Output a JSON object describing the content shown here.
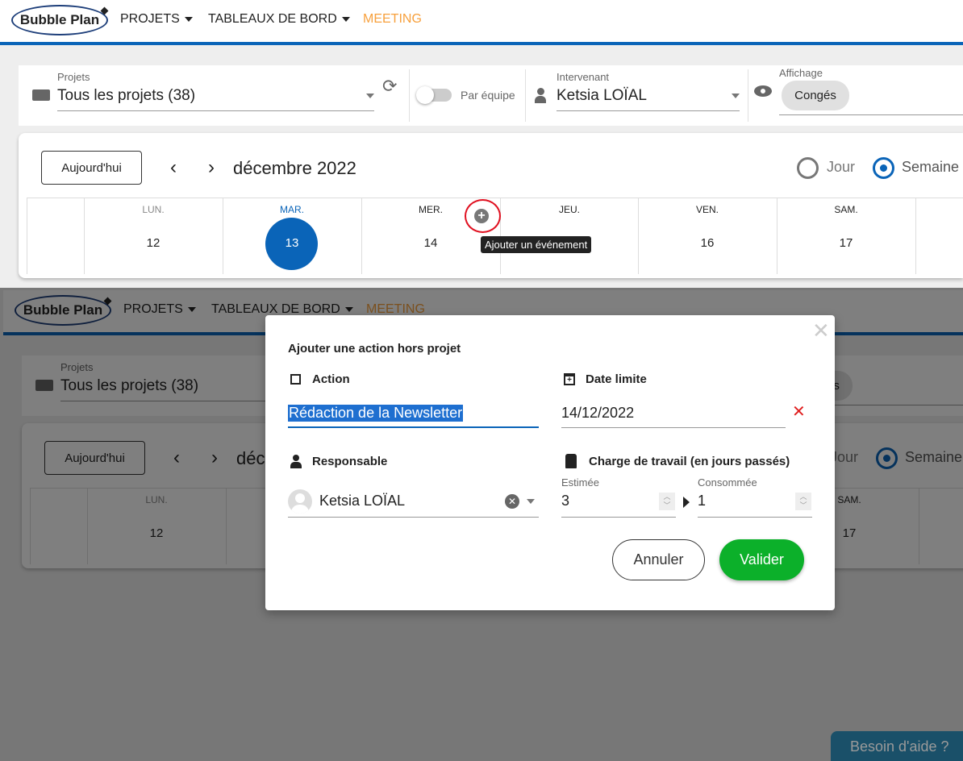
{
  "header": {
    "logo": "Bubble Plan",
    "nav": [
      {
        "label": "PROJETS"
      },
      {
        "label": "TABLEAUX DE BORD"
      },
      {
        "label": "MEETING"
      }
    ],
    "accent": "#0a64b8",
    "meeting_color": "#f7a03c"
  },
  "filters": {
    "projects": {
      "label": "Projets",
      "value": "Tous les projets (38)"
    },
    "team_toggle": {
      "label": "Par équipe",
      "on": false
    },
    "assignee": {
      "label": "Intervenant",
      "value": "Ketsia LOÏAL"
    },
    "display": {
      "label": "Affichage",
      "chip": "Congés"
    }
  },
  "calendar": {
    "today_button": "Aujourd'hui",
    "month": "décembre 2022",
    "views": [
      {
        "label": "Jour",
        "selected": false
      },
      {
        "label": "Semaine",
        "selected": true
      }
    ],
    "days": [
      {
        "name": "LUN.",
        "num": "12"
      },
      {
        "name": "MAR.",
        "num": "13",
        "today": true
      },
      {
        "name": "MER.",
        "num": "14"
      },
      {
        "name": "JEU.",
        "num": ""
      },
      {
        "name": "VEN.",
        "num": "16"
      },
      {
        "name": "SAM.",
        "num": "17"
      }
    ],
    "add_tooltip": "Ajouter un événement"
  },
  "modal": {
    "title": "Ajouter une action hors projet",
    "action_label": "Action",
    "action_value": "Rédaction de la Newsletter",
    "deadline_label": "Date limite",
    "deadline_value": "14/12/2022",
    "owner_label": "Responsable",
    "owner_value": "Ketsia LOÏAL",
    "workload_label": "Charge de travail (en jours passés)",
    "estimated_label": "Estimée",
    "estimated_value": "3",
    "consumed_label": "Consommée",
    "consumed_value": "1",
    "cancel": "Annuler",
    "submit": "Valider",
    "submit_color": "#0cb02a"
  },
  "help_button": "Besoin d'aide ?"
}
